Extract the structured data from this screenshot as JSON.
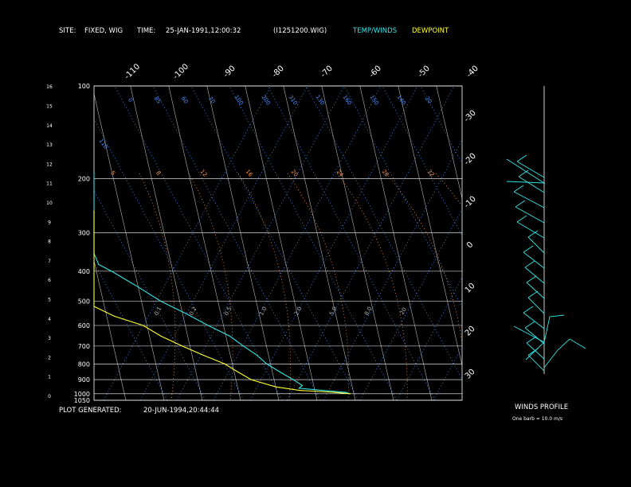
{
  "header": {
    "site_label": "SITE:",
    "site_value": "FIXED, WIG",
    "time_label": "TIME:",
    "time_value": "25-JAN-1991,12:00:32",
    "file_value": "(I1251200.WIG)",
    "temp_label": "TEMP/WINDS",
    "dew_label": "DEWPOINT"
  },
  "footer": {
    "generated_label": "PLOT GENERATED:",
    "generated_value": "20-JUN-1994,20:44:44"
  },
  "winds_panel": {
    "title": "WINDS PROFILE",
    "note": "One barb = 10.0 m/s"
  },
  "colors": {
    "temperature": "#33e6e6",
    "dewpoint": "#ffff33",
    "isotherm": "#b4b4b4",
    "mixing_ratio": "#4a90ff",
    "dry_adiabat": "#ff9940",
    "moist_adiabat": "#4a90ff",
    "frame": "#ffffff"
  },
  "chart_data": {
    "type": "line",
    "title": "",
    "pressure_labels": [
      "100",
      "200",
      "300",
      "400",
      "500",
      "600",
      "700",
      "800",
      "900",
      "1000",
      "1050"
    ],
    "pressure_values": [
      100,
      200,
      300,
      400,
      500,
      600,
      700,
      800,
      900,
      1000,
      1050
    ],
    "height_km_labels": [
      "0",
      "1",
      "2",
      "3",
      "4",
      "5",
      "6",
      "7",
      "8",
      "9",
      "10",
      "11",
      "12",
      "13",
      "14",
      "15",
      "16"
    ],
    "isotherm_top_labels": [
      "-110",
      "-100",
      "-90",
      "-80",
      "-70",
      "-60",
      "-50",
      "-40"
    ],
    "isotherm_right_labels": [
      "-30",
      "-20",
      "-10",
      "0",
      "10",
      "20",
      "30"
    ],
    "isotherm_range_c": [
      -130,
      40
    ],
    "mixing_ratio_labels": [
      "0.1",
      "0.2",
      "0.5",
      "1.0",
      "2.0",
      "5.0",
      "8.0",
      "20"
    ],
    "dry_adiabat_labels": [
      "110",
      "0",
      "85",
      "60",
      "70",
      "100",
      "200",
      "310",
      "130",
      "160",
      "150",
      "140",
      "20"
    ],
    "moist_adiabat_labels": [
      "5",
      "8",
      "12",
      "16",
      "20",
      "24",
      "28",
      "32"
    ],
    "grid": true,
    "series": [
      {
        "name": "TEMP/WINDS",
        "points": [
          {
            "p": 1000,
            "t": 9
          },
          {
            "p": 990,
            "t": 8
          },
          {
            "p": 975,
            "t": 2
          },
          {
            "p": 960,
            "t": -4
          },
          {
            "p": 940,
            "t": -3
          },
          {
            "p": 900,
            "t": -5
          },
          {
            "p": 850,
            "t": -8
          },
          {
            "p": 800,
            "t": -11
          },
          {
            "p": 750,
            "t": -13
          },
          {
            "p": 700,
            "t": -16
          },
          {
            "p": 650,
            "t": -19
          },
          {
            "p": 600,
            "t": -24
          },
          {
            "p": 550,
            "t": -29
          },
          {
            "p": 500,
            "t": -35
          },
          {
            "p": 450,
            "t": -40
          },
          {
            "p": 400,
            "t": -46
          },
          {
            "p": 380,
            "t": -49
          },
          {
            "p": 350,
            "t": -52
          },
          {
            "p": 320,
            "t": -54
          },
          {
            "p": 300,
            "t": -57
          },
          {
            "p": 280,
            "t": -58
          },
          {
            "p": 260,
            "t": -61
          },
          {
            "p": 240,
            "t": -63
          },
          {
            "p": 220,
            "t": -64
          },
          {
            "p": 200,
            "t": -66
          },
          {
            "p": 190,
            "t": -66
          }
        ]
      },
      {
        "name": "DEWPOINT",
        "points": [
          {
            "p": 1000,
            "t": 9
          },
          {
            "p": 990,
            "t": 5
          },
          {
            "p": 975,
            "t": -4
          },
          {
            "p": 950,
            "t": -10
          },
          {
            "p": 900,
            "t": -16
          },
          {
            "p": 850,
            "t": -19
          },
          {
            "p": 800,
            "t": -22
          },
          {
            "p": 750,
            "t": -27
          },
          {
            "p": 700,
            "t": -32
          },
          {
            "p": 650,
            "t": -37
          },
          {
            "p": 600,
            "t": -41
          },
          {
            "p": 560,
            "t": -48
          },
          {
            "p": 520,
            "t": -60
          },
          {
            "p": 500,
            "t": -95
          },
          {
            "p": 480,
            "t": -127
          },
          {
            "p": 420,
            "t": -130
          },
          {
            "p": 410,
            "t": -115
          },
          {
            "p": 395,
            "t": -110
          },
          {
            "p": 385,
            "t": -118
          },
          {
            "p": 375,
            "t": -130
          },
          {
            "p": 300,
            "t": -128
          },
          {
            "p": 260,
            "t": -130
          },
          {
            "p": 257,
            "t": -65
          },
          {
            "p": 255,
            "t": -130
          }
        ]
      }
    ],
    "wind_profile_heights_km": [
      0.2,
      1,
      2,
      3,
      4,
      5,
      6,
      7,
      8,
      9,
      10,
      11,
      12,
      13
    ]
  }
}
